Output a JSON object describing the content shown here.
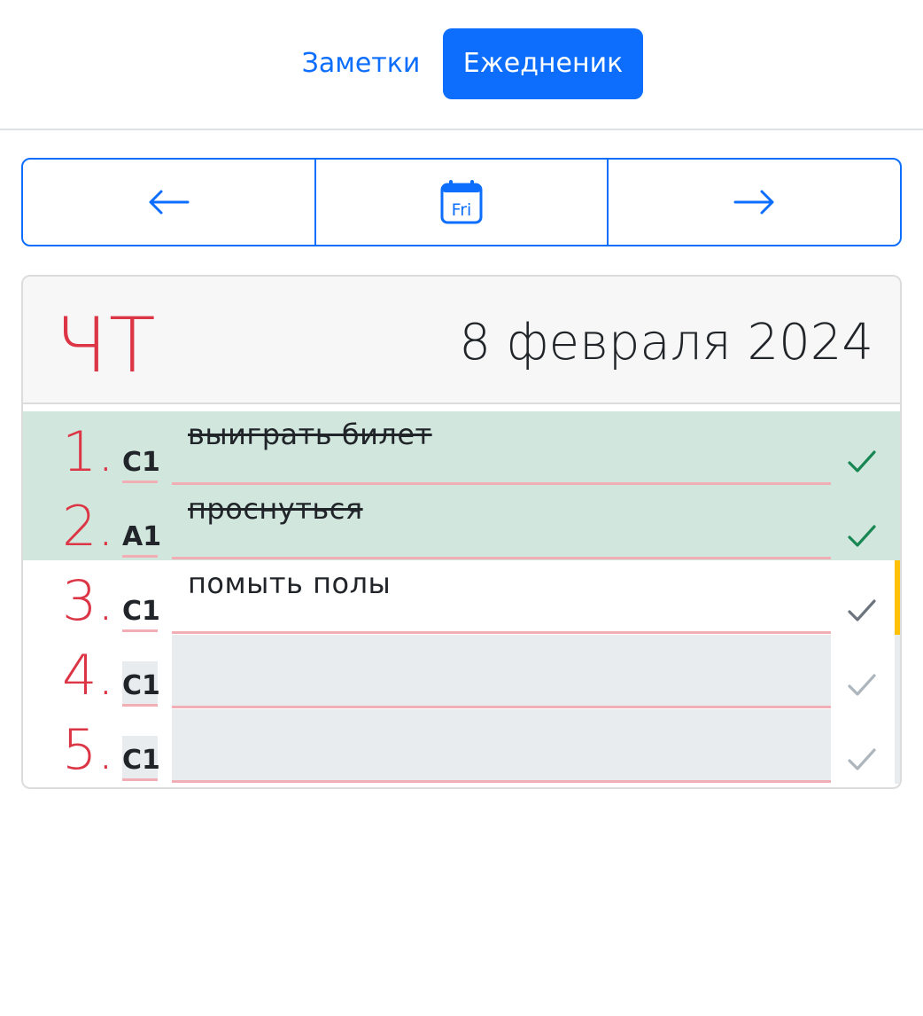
{
  "nav": {
    "tabs": [
      {
        "label": "Заметки",
        "active": false
      },
      {
        "label": "Ежедненик",
        "active": true
      }
    ]
  },
  "toolbar": {
    "prev_icon": "arrow-left-icon",
    "calendar_icon": "calendar-icon",
    "calendar_label": "Fri",
    "next_icon": "arrow-right-icon"
  },
  "day": {
    "weekday": "ЧТ",
    "date": "8 февраля 2024"
  },
  "tasks": [
    {
      "number": "1.",
      "code": "C1",
      "text": "выиграть билет",
      "done": true,
      "current": false
    },
    {
      "number": "2.",
      "code": "A1",
      "text": "проснуться",
      "done": true,
      "current": false
    },
    {
      "number": "3.",
      "code": "C1",
      "text": "помыть полы",
      "done": false,
      "current": true
    },
    {
      "number": "4.",
      "code": "C1",
      "text": "",
      "done": false,
      "current": false
    },
    {
      "number": "5.",
      "code": "C1",
      "text": "",
      "done": false,
      "current": false
    }
  ],
  "colors": {
    "primary": "#0d6efd",
    "danger": "#dc3545",
    "done_bg": "#d1e7dd",
    "check_done": "#198754",
    "check_current": "#6c757d",
    "check_empty": "#adb5bd",
    "current_marker": "#ffc107"
  }
}
